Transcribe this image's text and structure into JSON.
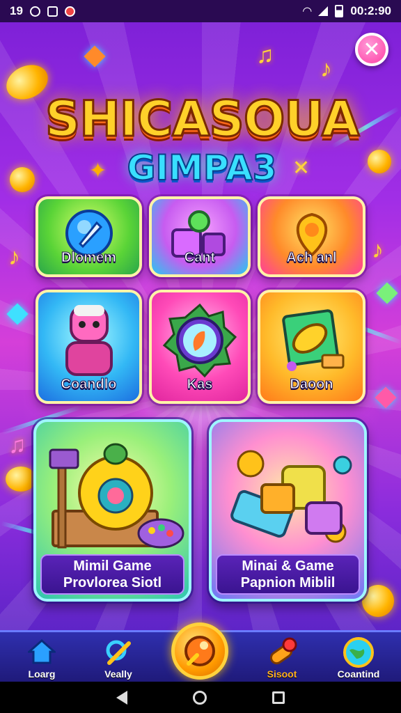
{
  "status_bar": {
    "left_text": "19",
    "time": "00:2:90",
    "icons": [
      "alarm-icon",
      "notification-icon",
      "app-icon",
      "wifi-icon",
      "signal-icon",
      "battery-icon"
    ]
  },
  "close_button": {
    "icon": "close-icon",
    "glyph": "✕"
  },
  "title": {
    "line1": "SHICASOUA",
    "line2": "GIMPA3"
  },
  "tiles": [
    {
      "label": "Dlomem",
      "icon": "rocket-icon"
    },
    {
      "label": "Cant",
      "icon": "blocks-icon"
    },
    {
      "label": "Ach anl",
      "icon": "guitar-pick-icon"
    },
    {
      "label": "Coandlo",
      "icon": "character-icon"
    },
    {
      "label": "Kas",
      "icon": "gear-gem-icon"
    },
    {
      "label": "Daoon",
      "icon": "paint-icon"
    }
  ],
  "cards": [
    {
      "line1": "Mimil Game",
      "line2": "Provlorea Siotl",
      "icon": "puzzle-toy-icon"
    },
    {
      "line1": "Minai & Game",
      "line2": "Papnion Miblil",
      "icon": "building-blocks-icon"
    }
  ],
  "bottom_nav": [
    {
      "label": "Loarg",
      "icon": "home-icon"
    },
    {
      "label": "Veally",
      "icon": "tools-icon"
    },
    {
      "label": "",
      "icon": "play-center-icon"
    },
    {
      "label": "Sisoot",
      "icon": "rocket-cannon-icon"
    },
    {
      "label": "Coantind",
      "icon": "globe-icon"
    }
  ],
  "colors": {
    "accent": "#ffd12a",
    "title_secondary": "#39e0ff",
    "nav_bg": "#1f1a7a",
    "close": "#ff3fa4"
  }
}
